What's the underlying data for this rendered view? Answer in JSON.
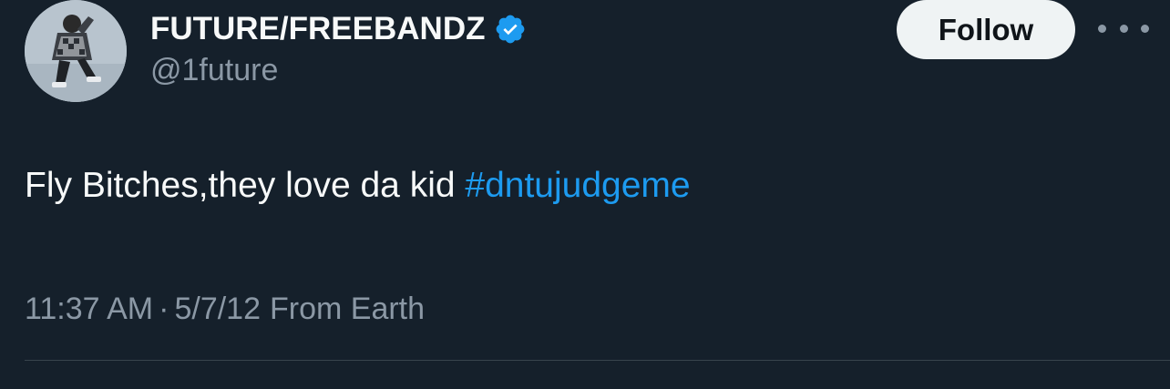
{
  "author": {
    "display_name": "FUTURE/FREEBANDZ",
    "handle": "@1future",
    "verified": true
  },
  "actions": {
    "follow_label": "Follow",
    "more_icon": "more-horizontal-icon"
  },
  "tweet": {
    "text": "Fly Bitches,they love da kid",
    "hashtag": "#dntujudgeme"
  },
  "meta": {
    "time": "11:37 AM",
    "separator": "·",
    "date": "5/7/12",
    "source": "From Earth"
  },
  "colors": {
    "background": "#15202b",
    "text_primary": "#f7f9f9",
    "text_secondary": "#8b98a5",
    "link": "#1d9bf0",
    "verified": "#1d9bf0",
    "follow_bg": "#eff3f4"
  }
}
